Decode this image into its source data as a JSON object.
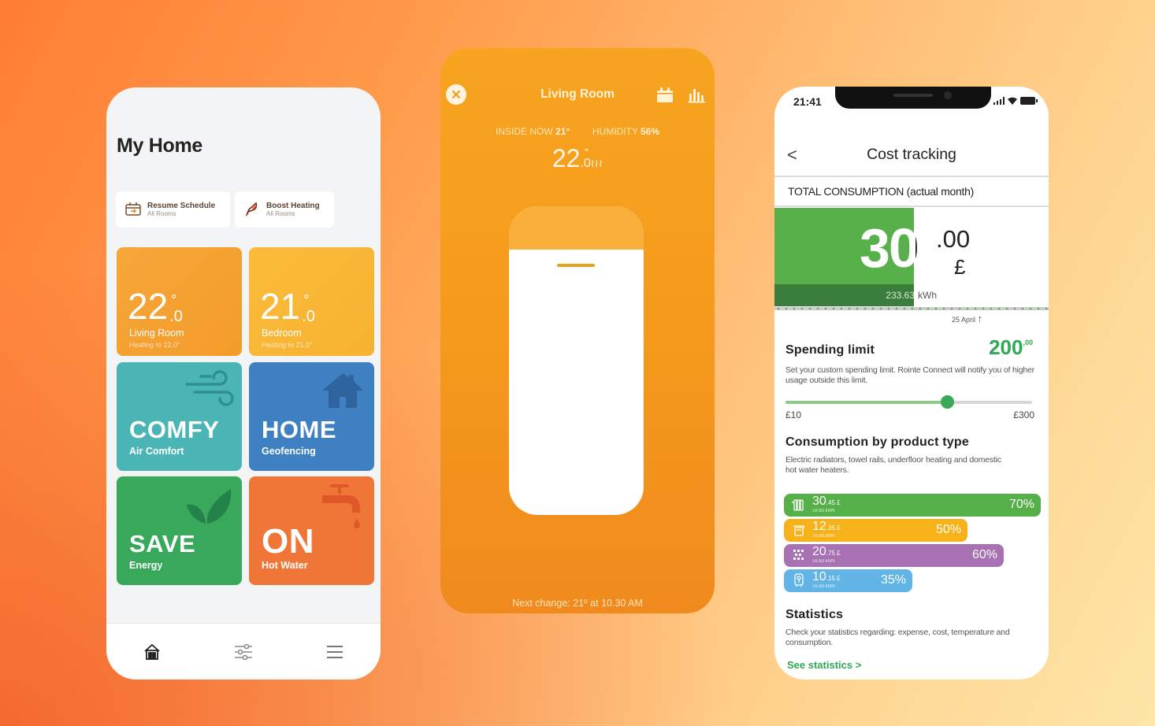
{
  "colors": {
    "living_room_tile": "#f5a032",
    "bedroom_tile": "#f9b735",
    "comfy_tile": "#4bb5b5",
    "home_tile": "#3f80c2",
    "save_tile": "#38a95b",
    "hot_water_tile": "#f07637",
    "accent_green": "#2da853",
    "thermostat_orange": "#f59a1c"
  },
  "my_home": {
    "title": "My Home",
    "quick_actions": [
      {
        "label": "Resume Schedule",
        "sub": "All Rooms",
        "icon": "calendar-resume-icon"
      },
      {
        "label": "Boost Heating",
        "sub": "All Rooms",
        "icon": "rocket-icon"
      }
    ],
    "rooms": [
      {
        "temp_int": "22",
        "temp_dec": "0",
        "deg": "°",
        "name": "Living Room",
        "status": "Heating to 22.0°"
      },
      {
        "temp_int": "21",
        "temp_dec": "0",
        "deg": "°",
        "name": "Bedroom",
        "status": "Heating to 21.0°"
      }
    ],
    "modes": [
      {
        "big": "COMFY",
        "label": "Air Comfort",
        "icon": "wind-icon"
      },
      {
        "big": "HOME",
        "label": "Geofencing",
        "icon": "house-icon"
      },
      {
        "big": "SAVE",
        "label": "Energy",
        "icon": "leaf-icon"
      },
      {
        "big": "ON",
        "label": "Hot Water",
        "icon": "faucet-icon"
      }
    ],
    "nav": [
      {
        "icon": "home-icon",
        "active": true
      },
      {
        "icon": "sliders-icon",
        "active": false
      },
      {
        "icon": "menu-icon",
        "active": false
      }
    ]
  },
  "thermostat": {
    "room": "Living Room",
    "inside_label": "INSIDE NOW",
    "inside_value": "21",
    "inside_unit": "°",
    "humidity_label": "HUMIDITY",
    "humidity_value": "56",
    "humidity_unit": "%",
    "target_int": "22",
    "target_dec": ".0",
    "target_deg": "°",
    "heating_glyph": "≀≀≀",
    "next_change": "Next change: 21º at 10.30 AM",
    "dial_level_pct": 86
  },
  "cost_tracking": {
    "status_time": "21:41",
    "title": "Cost tracking",
    "back": "<",
    "total_header": "TOTAL CONSUMPTION (actual month)",
    "total_int": "30",
    "total_cents": ".00",
    "currency": "£",
    "kwh_value": "233.63",
    "kwh_unit": "kWh",
    "progress_pct": 51,
    "date_marker": "25 April",
    "date_arrow": "↑",
    "spending_limit": {
      "title": "Spending limit",
      "value": "200",
      "value_cents": ",00",
      "value_currency": "£",
      "desc": "Set your custom spending limit. Rointe Connect will notify you of higher usage outside this limit.",
      "min_label": "£10",
      "max_label": "£300",
      "min": 10,
      "max": 300,
      "current": 200
    },
    "by_product": {
      "title": "Consumption by product type",
      "desc": "Electric radiators, towel rails, underfloor heating and domestic hot water heaters.",
      "items": [
        {
          "name": "radiator",
          "icon": "radiator-icon",
          "amount": "30",
          "cents": ".45 £",
          "kwh": "16.63 kWh",
          "percent": 70,
          "percent_label": "70%",
          "color": "#55b04a"
        },
        {
          "name": "towel-rail",
          "icon": "towel-rail-icon",
          "amount": "12",
          "cents": ".35 £",
          "kwh": "16.63 kWh",
          "percent": 50,
          "percent_label": "50%",
          "color": "#f7b21a"
        },
        {
          "name": "underfloor",
          "icon": "underfloor-icon",
          "amount": "20",
          "cents": ".75 £",
          "kwh": "16.63 kWh",
          "percent": 60,
          "percent_label": "60%",
          "color": "#a871b3"
        },
        {
          "name": "water-heater",
          "icon": "water-heater-icon",
          "amount": "10",
          "cents": ".15 £",
          "kwh": "16.63 kWh",
          "percent": 35,
          "percent_label": "35%",
          "color": "#62b3e6"
        }
      ]
    },
    "statistics": {
      "title": "Statistics",
      "desc": "Check your statistics regarding: expense, cost, temperature and consumption.",
      "link": "See statistics >"
    }
  }
}
